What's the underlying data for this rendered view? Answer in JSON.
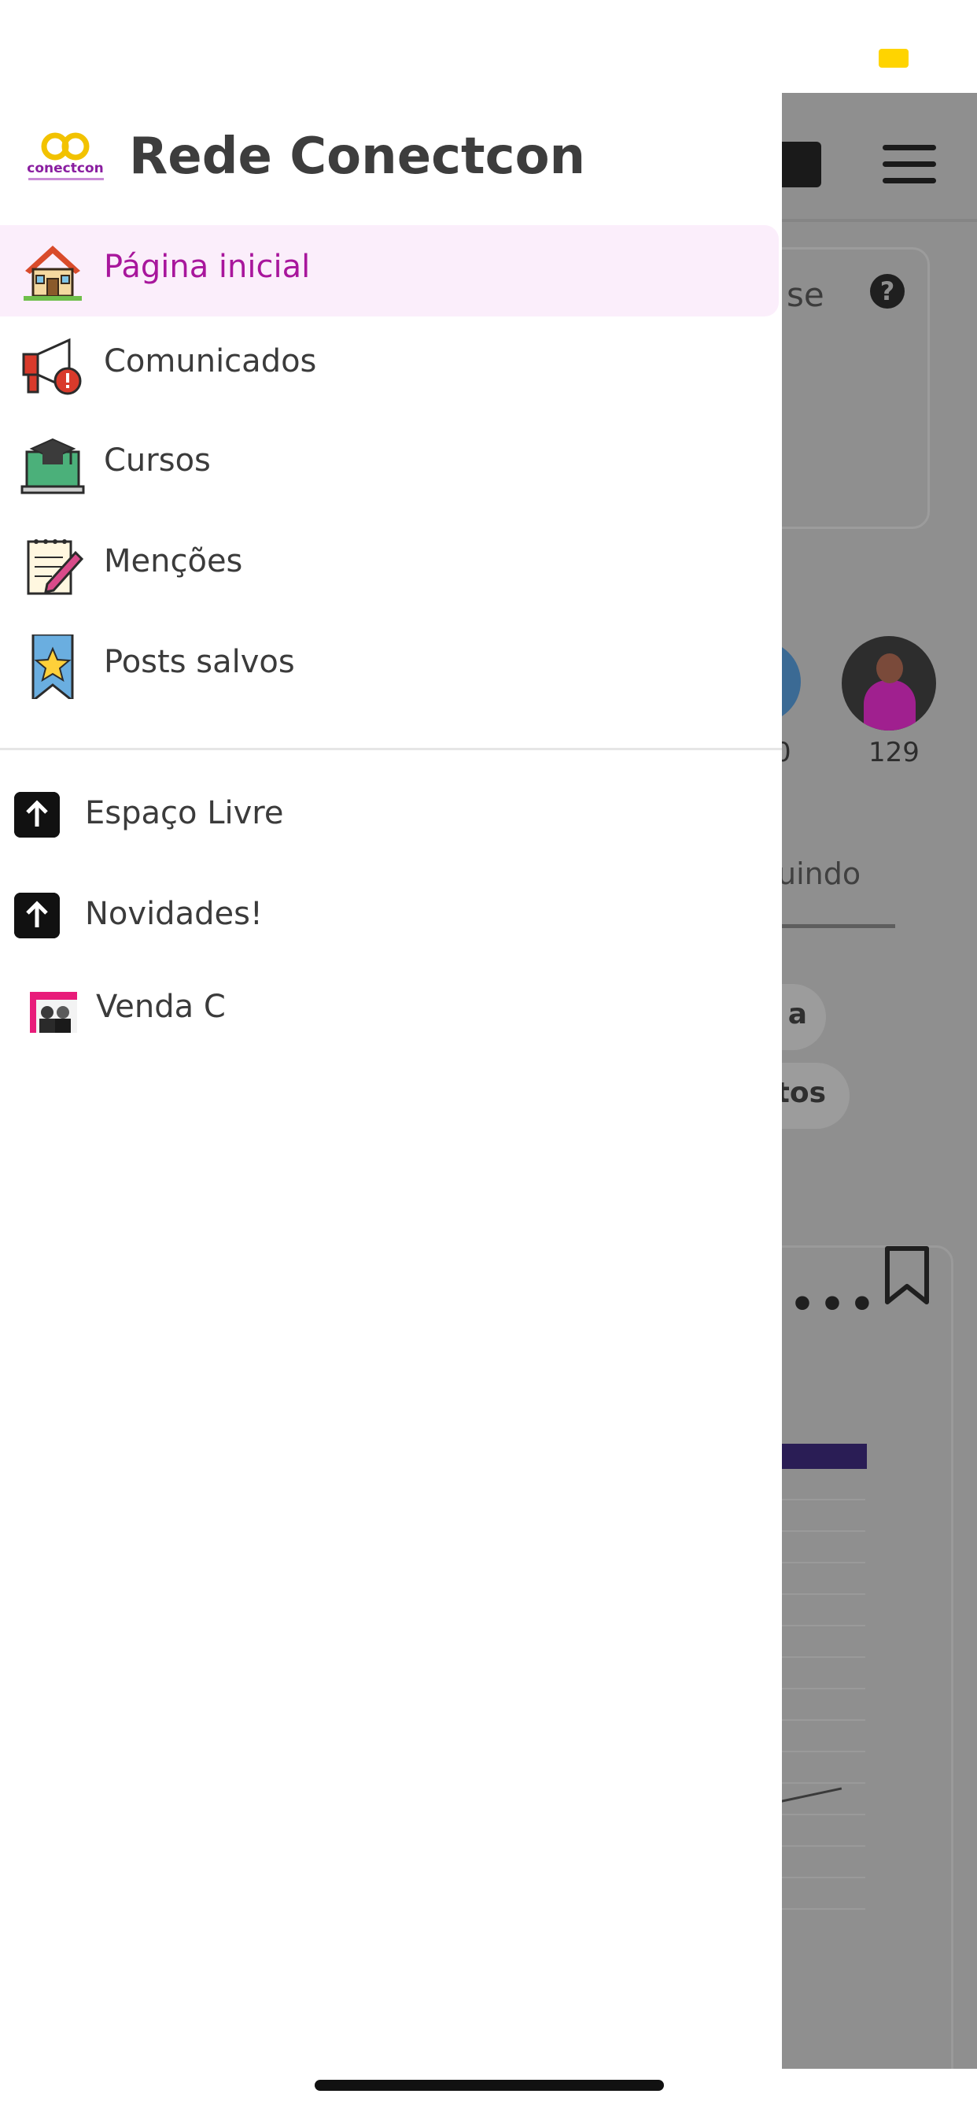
{
  "app": {
    "title": "Rede Conectcon",
    "logo_text": "conectcon"
  },
  "menu": {
    "items": [
      {
        "label": "Página inicial",
        "icon": "house-icon",
        "active": true
      },
      {
        "label": "Comunicados",
        "icon": "megaphone-icon"
      },
      {
        "label": "Cursos",
        "icon": "graduation-laptop-icon"
      },
      {
        "label": "Menções",
        "icon": "notepad-pen-icon"
      },
      {
        "label": "Posts salvos",
        "icon": "bookmark-star-icon"
      }
    ]
  },
  "spaces": [
    {
      "label": "Espaço Livre",
      "icon": "arrow-up-icon"
    },
    {
      "label": "Novidades!",
      "icon": "arrow-up-icon"
    },
    {
      "label": "Venda C",
      "icon": "venda-thumbnail"
    }
  ],
  "background": {
    "card_partial_text": "se",
    "help_symbol": "?",
    "story_count_partial": "0",
    "story_count": "129",
    "tab_partial": "uindo",
    "chip1_partial": "a",
    "chip2_partial": "tos",
    "more_symbol": "•••"
  },
  "colors": {
    "accent": "#a8169c",
    "active_bg": "#fbeefb",
    "logo_gold": "#f2c200",
    "status_indicator": "#ffd400"
  }
}
